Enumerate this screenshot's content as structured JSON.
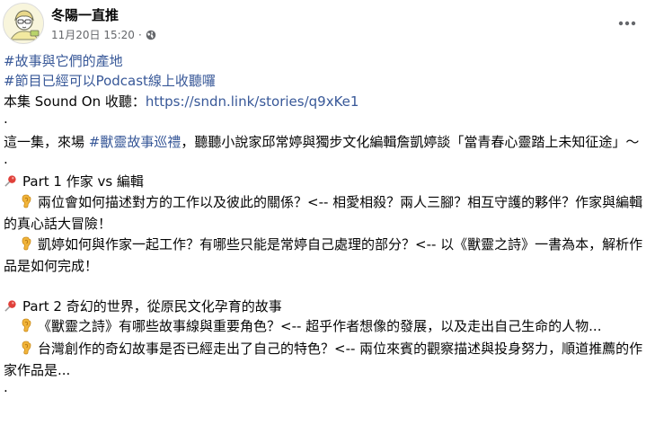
{
  "post": {
    "page_name": "冬陽一直推",
    "timestamp": "11月20日 15:20",
    "separator": "·",
    "audience_icon": "globe-icon",
    "more_icon": "more-horizontal-icon"
  },
  "content": {
    "hashtag1": "#故事與它們的產地",
    "hashtag2": "#節目已經可以Podcast線上收聽囉",
    "listen_prefix": "本集 Sound On 收聽：",
    "listen_link": "https://sndn.link/stories/q9xKe1",
    "dot": ".",
    "intro_before": "這一集，來場 ",
    "intro_tag": "#獸靈故事巡禮",
    "intro_after": "，聽聽小說家邱常婷與獨步文化編輯詹凱婷談「當青春心靈踏上未知征途」～",
    "part1_title": "Part 1  作家 vs 編輯",
    "p1_item1": "兩位會如何描述對方的工作以及彼此的關係？<-- 相愛相殺？兩人三腳？相互守護的夥伴？作家與編輯的真心話大冒險！",
    "p1_item2": "凱婷如何與作家一起工作？有哪些只能是常婷自己處理的部分？<-- 以《獸靈之詩》一書為本，解析作品是如何完成！",
    "part2_title": "Part 2  奇幻的世界，從原民文化孕育的故事",
    "p2_item1": "《獸靈之詩》有哪些故事線與重要角色？<-- 超乎作者想像的發展，以及走出自己生命的人物...",
    "p2_item2": "台灣創作的奇幻故事是否已經走出了自己的特色？<-- 兩位來賓的觀察描述與投身努力，順道推薦的作家作品是..."
  },
  "icons": {
    "pin": "pushpin-icon",
    "ear": "ear-icon"
  }
}
